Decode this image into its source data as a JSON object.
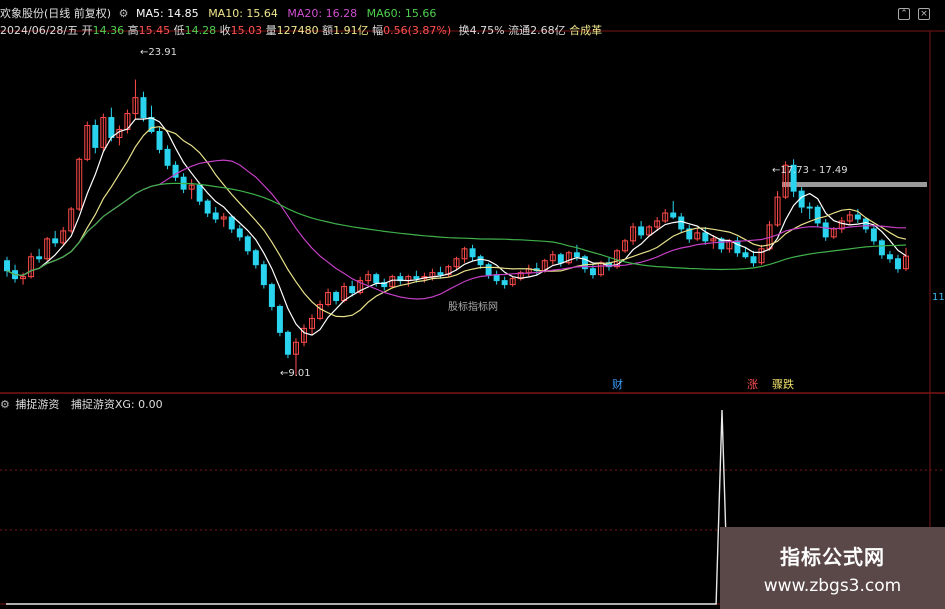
{
  "colors": {
    "up": "#ff4b4b",
    "down": "#2ad4ee",
    "ma5": "#ffffff",
    "ma10": "#e8e08a",
    "ma20": "#c43fc4",
    "ma60": "#3fb04a",
    "grid": "#7a1616",
    "signal": "#e8e8e8"
  },
  "header": {
    "stock_name": "欢象股份(日线 前复权)",
    "ma5_label": "MA5: 14.85",
    "ma10_label": "MA10: 15.64",
    "ma20_label": "MA20: 16.28",
    "ma60_label": "MA60: 15.66",
    "date": "2024/06/28/五",
    "open_label": "开",
    "open_value": "14.36",
    "high_label": "高",
    "high_value": "15.45",
    "low_label": "低",
    "low_value": "14.28",
    "close_label": "收",
    "close_value": "15.03",
    "volume_label": "量",
    "volume_value": "127480",
    "amount_label": "额",
    "amount_value": "1.91亿",
    "change_label": "幅",
    "change_value": "0.56(3.87%)",
    "turnover": "换4.75%",
    "float_cap": "流通2.68亿",
    "sector": "合成革"
  },
  "annotations": {
    "high_mark": "23.91",
    "low_mark": "9.01",
    "range_mark": "17.73 - 17.49",
    "center_watermark": "股标指标网",
    "right_edge_label": "11",
    "tag_cai": "财",
    "tag_zhang": "涨",
    "tag_jiaodie": "骤跌"
  },
  "indicator": {
    "title": "捕捉游资",
    "value_label": "捕捉游资XG: 0.00"
  },
  "watermark": {
    "line1": "指标公式网",
    "line2": "www.zbgs3.com"
  },
  "chart_data": {
    "type": "candlestick",
    "candles_ohlc": [
      [
        14.8,
        15.0,
        14.0,
        14.3
      ],
      [
        14.3,
        14.6,
        13.7,
        13.9
      ],
      [
        13.9,
        14.2,
        13.6,
        14.0
      ],
      [
        14.0,
        15.2,
        13.9,
        15.0
      ],
      [
        15.0,
        15.4,
        14.7,
        14.9
      ],
      [
        14.9,
        16.0,
        14.8,
        15.9
      ],
      [
        15.9,
        16.3,
        15.5,
        15.7
      ],
      [
        15.7,
        16.5,
        15.6,
        16.3
      ],
      [
        16.3,
        17.5,
        16.2,
        17.4
      ],
      [
        17.4,
        20.0,
        17.3,
        19.9
      ],
      [
        19.9,
        21.8,
        19.8,
        21.6
      ],
      [
        21.6,
        21.9,
        20.2,
        20.5
      ],
      [
        20.5,
        22.2,
        20.3,
        22.0
      ],
      [
        22.0,
        22.5,
        20.8,
        21.0
      ],
      [
        21.0,
        21.6,
        20.6,
        21.4
      ],
      [
        21.4,
        22.4,
        21.2,
        22.2
      ],
      [
        22.2,
        23.91,
        21.9,
        23.0
      ],
      [
        23.0,
        23.3,
        21.8,
        22.0
      ],
      [
        22.0,
        22.6,
        21.2,
        21.3
      ],
      [
        21.3,
        21.5,
        20.2,
        20.4
      ],
      [
        20.4,
        20.6,
        19.4,
        19.6
      ],
      [
        19.6,
        19.8,
        18.8,
        19.0
      ],
      [
        19.0,
        19.2,
        18.2,
        18.4
      ],
      [
        18.4,
        18.9,
        17.9,
        18.6
      ],
      [
        18.6,
        18.7,
        17.6,
        17.8
      ],
      [
        17.8,
        17.9,
        17.0,
        17.2
      ],
      [
        17.2,
        17.5,
        16.7,
        16.9
      ],
      [
        16.9,
        17.2,
        16.5,
        17.0
      ],
      [
        17.0,
        17.1,
        16.2,
        16.4
      ],
      [
        16.4,
        16.6,
        15.8,
        16.0
      ],
      [
        16.0,
        16.1,
        15.1,
        15.3
      ],
      [
        15.3,
        15.4,
        14.4,
        14.6
      ],
      [
        14.6,
        14.8,
        13.4,
        13.6
      ],
      [
        13.6,
        13.7,
        12.3,
        12.5
      ],
      [
        12.5,
        12.6,
        11.0,
        11.2
      ],
      [
        11.2,
        11.3,
        9.9,
        10.1
      ],
      [
        10.1,
        10.9,
        9.01,
        10.7
      ],
      [
        10.7,
        11.6,
        10.5,
        11.4
      ],
      [
        11.4,
        12.1,
        11.1,
        11.9
      ],
      [
        11.9,
        12.8,
        11.8,
        12.6
      ],
      [
        12.6,
        13.4,
        12.5,
        13.2
      ],
      [
        13.2,
        13.3,
        12.6,
        12.8
      ],
      [
        12.8,
        13.7,
        12.7,
        13.5
      ],
      [
        13.5,
        13.8,
        13.0,
        13.2
      ],
      [
        13.2,
        14.0,
        13.1,
        13.8
      ],
      [
        13.8,
        14.3,
        13.6,
        14.1
      ],
      [
        14.1,
        14.2,
        13.5,
        13.7
      ],
      [
        13.7,
        13.9,
        13.3,
        13.5
      ],
      [
        13.5,
        14.1,
        13.4,
        14.0
      ],
      [
        14.0,
        14.2,
        13.6,
        13.8
      ],
      [
        13.8,
        14.1,
        13.5,
        14.0
      ],
      [
        14.0,
        14.3,
        13.7,
        13.9
      ],
      [
        13.9,
        14.2,
        13.7,
        14.0
      ],
      [
        14.0,
        14.4,
        13.8,
        14.2
      ],
      [
        14.2,
        14.5,
        13.9,
        14.1
      ],
      [
        14.1,
        14.6,
        14.0,
        14.5
      ],
      [
        14.5,
        15.0,
        14.3,
        14.9
      ],
      [
        14.9,
        15.5,
        14.7,
        15.4
      ],
      [
        15.4,
        15.6,
        14.8,
        15.0
      ],
      [
        15.0,
        15.1,
        14.4,
        14.6
      ],
      [
        14.6,
        14.7,
        13.9,
        14.1
      ],
      [
        14.1,
        14.3,
        13.6,
        13.8
      ],
      [
        13.8,
        14.0,
        13.4,
        13.6
      ],
      [
        13.6,
        14.0,
        13.5,
        13.9
      ],
      [
        13.9,
        14.3,
        13.8,
        14.2
      ],
      [
        14.2,
        14.6,
        14.0,
        14.4
      ],
      [
        14.4,
        14.7,
        14.1,
        14.3
      ],
      [
        14.3,
        14.9,
        14.2,
        14.8
      ],
      [
        14.8,
        15.3,
        14.6,
        15.1
      ],
      [
        15.1,
        15.2,
        14.5,
        14.7
      ],
      [
        14.7,
        15.3,
        14.6,
        15.2
      ],
      [
        15.2,
        15.6,
        14.8,
        15.0
      ],
      [
        15.0,
        15.1,
        14.2,
        14.4
      ],
      [
        14.4,
        14.6,
        13.9,
        14.1
      ],
      [
        14.1,
        14.8,
        14.0,
        14.7
      ],
      [
        14.7,
        15.0,
        14.3,
        14.5
      ],
      [
        14.5,
        15.4,
        14.4,
        15.3
      ],
      [
        15.3,
        15.9,
        15.2,
        15.8
      ],
      [
        15.8,
        16.7,
        15.6,
        16.5
      ],
      [
        16.5,
        16.8,
        15.9,
        16.1
      ],
      [
        16.1,
        16.6,
        16.0,
        16.5
      ],
      [
        16.5,
        17.0,
        16.3,
        16.8
      ],
      [
        16.8,
        17.4,
        16.7,
        17.2
      ],
      [
        17.2,
        17.8,
        16.9,
        17.0
      ],
      [
        17.0,
        17.2,
        16.2,
        16.4
      ],
      [
        16.4,
        16.6,
        15.7,
        15.9
      ],
      [
        15.9,
        16.4,
        15.8,
        16.2
      ],
      [
        16.2,
        16.5,
        15.6,
        15.8
      ],
      [
        15.8,
        16.1,
        15.4,
        15.9
      ],
      [
        15.9,
        16.0,
        15.2,
        15.4
      ],
      [
        15.4,
        15.9,
        15.2,
        15.8
      ],
      [
        15.8,
        16.0,
        15.0,
        15.2
      ],
      [
        15.2,
        15.5,
        14.9,
        15.0
      ],
      [
        15.0,
        15.3,
        14.5,
        14.7
      ],
      [
        14.7,
        15.6,
        14.6,
        15.4
      ],
      [
        15.4,
        16.8,
        15.3,
        16.6
      ],
      [
        16.6,
        18.3,
        16.5,
        18.0
      ],
      [
        18.0,
        19.8,
        17.9,
        19.6
      ],
      [
        19.6,
        19.9,
        18.0,
        18.3
      ],
      [
        18.3,
        18.5,
        17.2,
        17.5
      ],
      [
        17.5,
        17.73,
        16.9,
        17.49
      ],
      [
        17.49,
        17.6,
        16.5,
        16.7
      ],
      [
        16.7,
        16.9,
        15.8,
        16.0
      ],
      [
        16.0,
        16.5,
        15.9,
        16.4
      ],
      [
        16.4,
        17.0,
        16.2,
        16.8
      ],
      [
        16.8,
        17.3,
        16.6,
        17.1
      ],
      [
        17.1,
        17.4,
        16.7,
        16.9
      ],
      [
        16.9,
        17.0,
        16.2,
        16.4
      ],
      [
        16.4,
        16.6,
        15.6,
        15.8
      ],
      [
        15.8,
        15.9,
        14.9,
        15.1
      ],
      [
        15.1,
        15.3,
        14.7,
        14.9
      ],
      [
        14.9,
        15.1,
        14.2,
        14.4
      ],
      [
        14.4,
        15.45,
        14.28,
        15.03
      ]
    ],
    "ma_periods": [
      5,
      10,
      20,
      60
    ],
    "ylim": [
      8.2,
      26.0
    ],
    "signal_series": [
      0,
      0,
      0,
      0,
      0,
      0,
      0,
      0,
      0,
      0,
      0,
      0,
      0,
      0,
      0,
      0,
      0,
      0,
      0,
      0,
      0,
      0,
      0,
      0,
      0,
      0,
      0,
      0,
      0,
      0,
      0,
      0,
      0,
      0,
      0,
      0,
      0,
      0,
      0,
      0,
      0,
      0,
      0,
      0,
      0,
      0,
      0,
      0,
      0,
      0,
      0,
      0,
      0,
      0,
      0,
      0,
      0,
      0,
      0,
      0,
      0,
      0,
      0,
      0,
      0,
      0,
      0,
      0,
      0,
      0,
      0,
      0,
      0,
      0,
      0,
      0,
      0,
      0,
      0,
      0,
      0,
      0,
      0,
      0,
      0,
      0,
      0,
      0,
      0,
      0,
      0,
      0,
      0,
      0,
      0,
      0,
      0,
      0,
      0,
      0,
      0,
      0,
      0,
      0,
      0,
      0,
      0,
      0,
      0,
      0,
      0,
      0,
      0,
      0,
      0,
      0,
      0,
      0,
      0,
      0,
      1,
      0,
      0,
      0,
      0,
      0,
      0,
      0,
      0,
      0,
      0,
      0,
      0,
      0,
      0,
      0,
      0,
      0,
      0,
      0,
      0,
      0,
      0,
      0,
      0,
      0,
      0,
      0,
      0,
      0,
      0,
      0
    ],
    "signal_ylim": [
      0,
      1
    ]
  }
}
